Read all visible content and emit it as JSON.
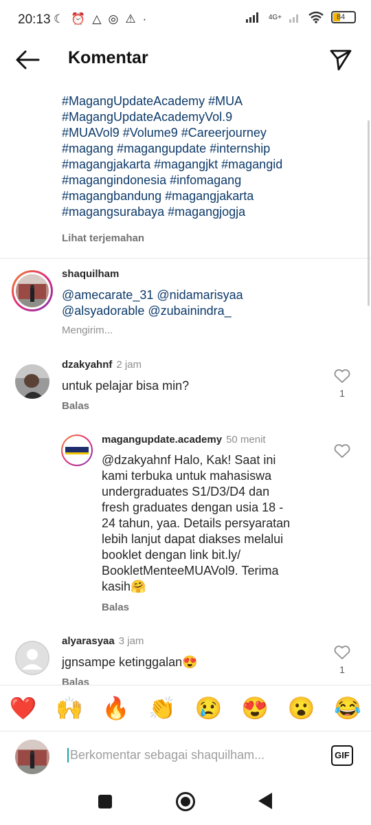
{
  "status_bar": {
    "time": "20:13",
    "network": "4G+",
    "battery": "84"
  },
  "header": {
    "title": "Komentar"
  },
  "caption": {
    "hashtags": "#MagangUpdateAcademy #MUA\n#MagangUpdateAcademyVol.9\n#MUAVol9 #Volume9 #Careerjourney\n#magang #magangupdate #internship\n#magangjakarta #magangjkt #magangid\n#magangindonesia #infomagang\n#magangbandung #magangjakarta\n#magangsurabaya  #magangjogja",
    "translate_label": "Lihat terjemahan"
  },
  "comments": [
    {
      "username": "shaquilham",
      "time": "",
      "text": "@amecarate_31 @nidamarisyaa\n@alsyadorable @zubainindra_",
      "status": "Mengirim..."
    },
    {
      "username": "dzakyahnf",
      "time": "2 jam",
      "text": "untuk pelajar bisa min?",
      "reply_label": "Balas",
      "likes": "1"
    },
    {
      "username": "magangupdate.academy",
      "time": "50 menit",
      "text": "@dzakyahnf Halo, Kak! Saat ini\nkami terbuka untuk mahasiswa\nundergraduates S1/D3/D4 dan\nfresh graduates dengan usia 18 -\n24 tahun, yaa. Details persyaratan\nlebih lanjut dapat diakses melalui\nbooklet dengan link bit.ly/\nBookletMenteeMUAVol9. Terima\nkasih🤗",
      "reply_label": "Balas",
      "avatar_label": "MagangUpdate Academy"
    },
    {
      "username": "alyarasyaa",
      "time": "3 jam",
      "text": "jgnsampe ketinggalan😍",
      "reply_label": "Balas",
      "likes": "1"
    }
  ],
  "reactions": [
    "❤️",
    "🙌",
    "🔥",
    "👏",
    "😢",
    "😍",
    "😮",
    "😂"
  ],
  "input": {
    "placeholder": "Berkomentar sebagai shaquilham...",
    "gif_label": "GIF"
  },
  "colors": {
    "hashtag": "#0d3a6a",
    "story_ring_start": "#f58529",
    "story_ring_end": "#c13584"
  }
}
